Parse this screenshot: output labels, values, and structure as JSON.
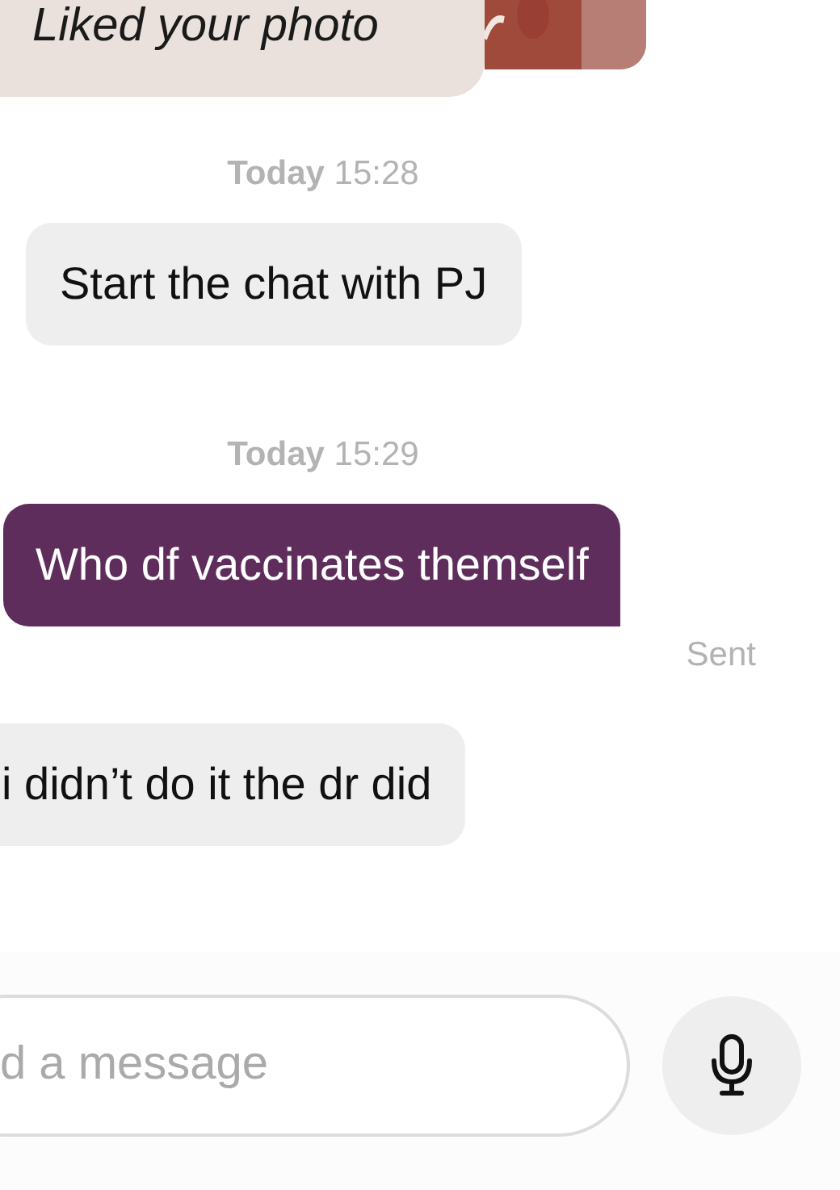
{
  "messages": [
    {
      "kind": "reaction",
      "text": "Liked your photo"
    },
    {
      "kind": "timestamp",
      "day": "Today",
      "time": "15:28"
    },
    {
      "kind": "received",
      "text": "Start the chat with PJ"
    },
    {
      "kind": "timestamp",
      "day": "Today",
      "time": "15:29"
    },
    {
      "kind": "sent",
      "text": "Who df vaccinates themself",
      "status": "Sent"
    },
    {
      "kind": "received",
      "text": "i didn’t do it the dr did"
    }
  ],
  "composer": {
    "placeholder": "d a message"
  }
}
